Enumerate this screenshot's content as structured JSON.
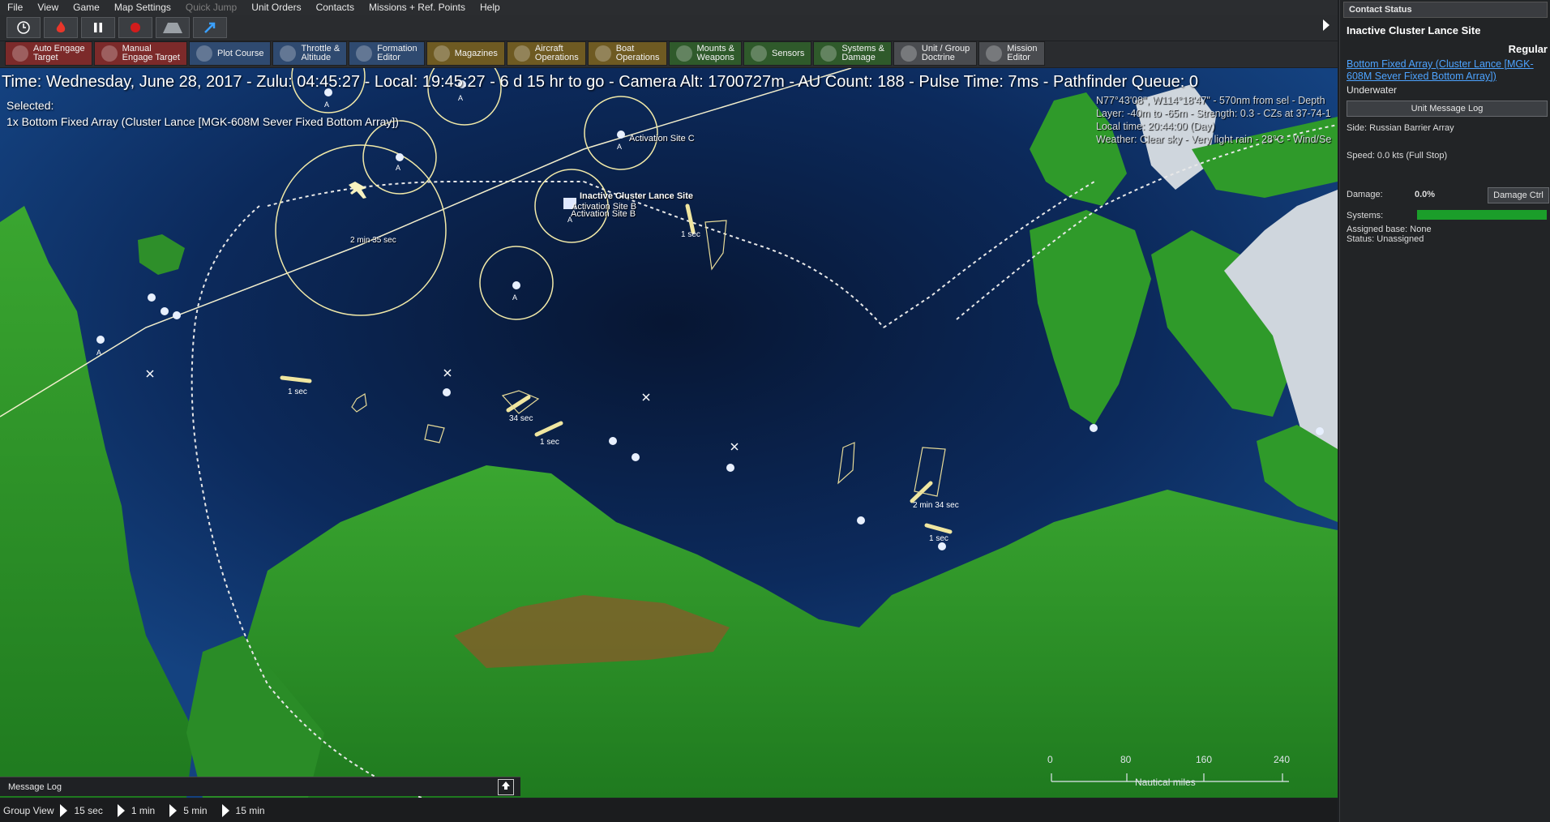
{
  "menu": [
    "File",
    "View",
    "Game",
    "Map Settings",
    "Quick Jump",
    "Unit Orders",
    "Contacts",
    "Missions + Ref. Points",
    "Help"
  ],
  "toolbar": [
    {
      "label": "Auto Engage\nTarget",
      "style": "red"
    },
    {
      "label": "Manual\nEngage Target",
      "style": "red"
    },
    {
      "label": "Plot Course",
      "style": "blue"
    },
    {
      "label": "Throttle &\nAltitude",
      "style": "blue"
    },
    {
      "label": "Formation\nEditor",
      "style": "blue"
    },
    {
      "label": "Magazines",
      "style": "olive"
    },
    {
      "label": "Aircraft\nOperations",
      "style": "olive"
    },
    {
      "label": "Boat\nOperations",
      "style": "olive"
    },
    {
      "label": "Mounts &\nWeapons",
      "style": "green"
    },
    {
      "label": "Sensors",
      "style": "green"
    },
    {
      "label": "Systems &\nDamage",
      "style": "green"
    },
    {
      "label": "Unit / Group\nDoctrine",
      "style": "gray"
    },
    {
      "label": "Mission\nEditor",
      "style": "gray"
    }
  ],
  "status_line": "Time: Wednesday, June 28, 2017 - Zulu: 04:45:27 - Local: 19:45:27 - 6 d 15 hr to go -  Camera Alt: 1700727m  - AU Count: 188 - Pulse Time: 7ms - Pathfinder Queue: 0",
  "selected": {
    "label": "Selected:",
    "unit": "1x Bottom Fixed Array (Cluster Lance [MGK-608M Sever Fixed Bottom Array])"
  },
  "hover_info": [
    "N77°43'08\", W114°18'47\" - 570nm from sel - Depth",
    "Layer: -40m to -65m - Strength: 0.3 - CZs at 37-74-1",
    "Local time: 20:44:00 (Day)",
    "Weather: Clear sky - Very light rain - 28°C - Wind/Se"
  ],
  "map_labels": {
    "inactive_site": "Inactive Cluster Lance Site",
    "act_b1": "Activation Site B",
    "act_b2": "Activation Site B",
    "act_c": "Activation Site C",
    "time_2m35": "2 min 35 sec",
    "time_1s_a": "1 sec",
    "time_1s_b": "1 sec",
    "time_34s": "34 sec",
    "time_1s_c": "1 sec",
    "time_1s_d": "1 sec",
    "time_2m34": "2 min 34 sec",
    "time_1s_e": "1 sec",
    "a1": "A",
    "a2": "A",
    "a3": "A",
    "a4": "A",
    "a5": "A",
    "a6": "A",
    "a7": "A"
  },
  "scale": {
    "ticks": [
      "0",
      "80",
      "160",
      "240"
    ],
    "unit": "Nautical miles"
  },
  "message_log": "Message Log",
  "group_view": {
    "label": "Group View",
    "options": [
      "15 sec",
      "1 min",
      "5 min",
      "15 min"
    ]
  },
  "panel": {
    "title": "Contact Status",
    "name": "Inactive Cluster Lance Site",
    "proficiency": "Regular",
    "link": "Bottom Fixed Array (Cluster Lance [MGK-608M Sever Fixed Bottom Array])",
    "env": "Underwater",
    "msg_btn": "Unit Message Log",
    "side": "Side: Russian Barrier Array",
    "speed": "Speed: 0.0 kts (Full Stop)",
    "damage_label": "Damage:",
    "damage_value": "0.0%",
    "damage_btn": "Damage Ctrl",
    "systems_label": "Systems:",
    "assigned": "Assigned base: None",
    "status": "Status: Unassigned"
  },
  "colors": {
    "ocean_deep": "#0a1f45",
    "ocean": "#123a74",
    "land": "#2f8f2a",
    "ice": "#d8dde3",
    "range": "#f1e9a8"
  }
}
